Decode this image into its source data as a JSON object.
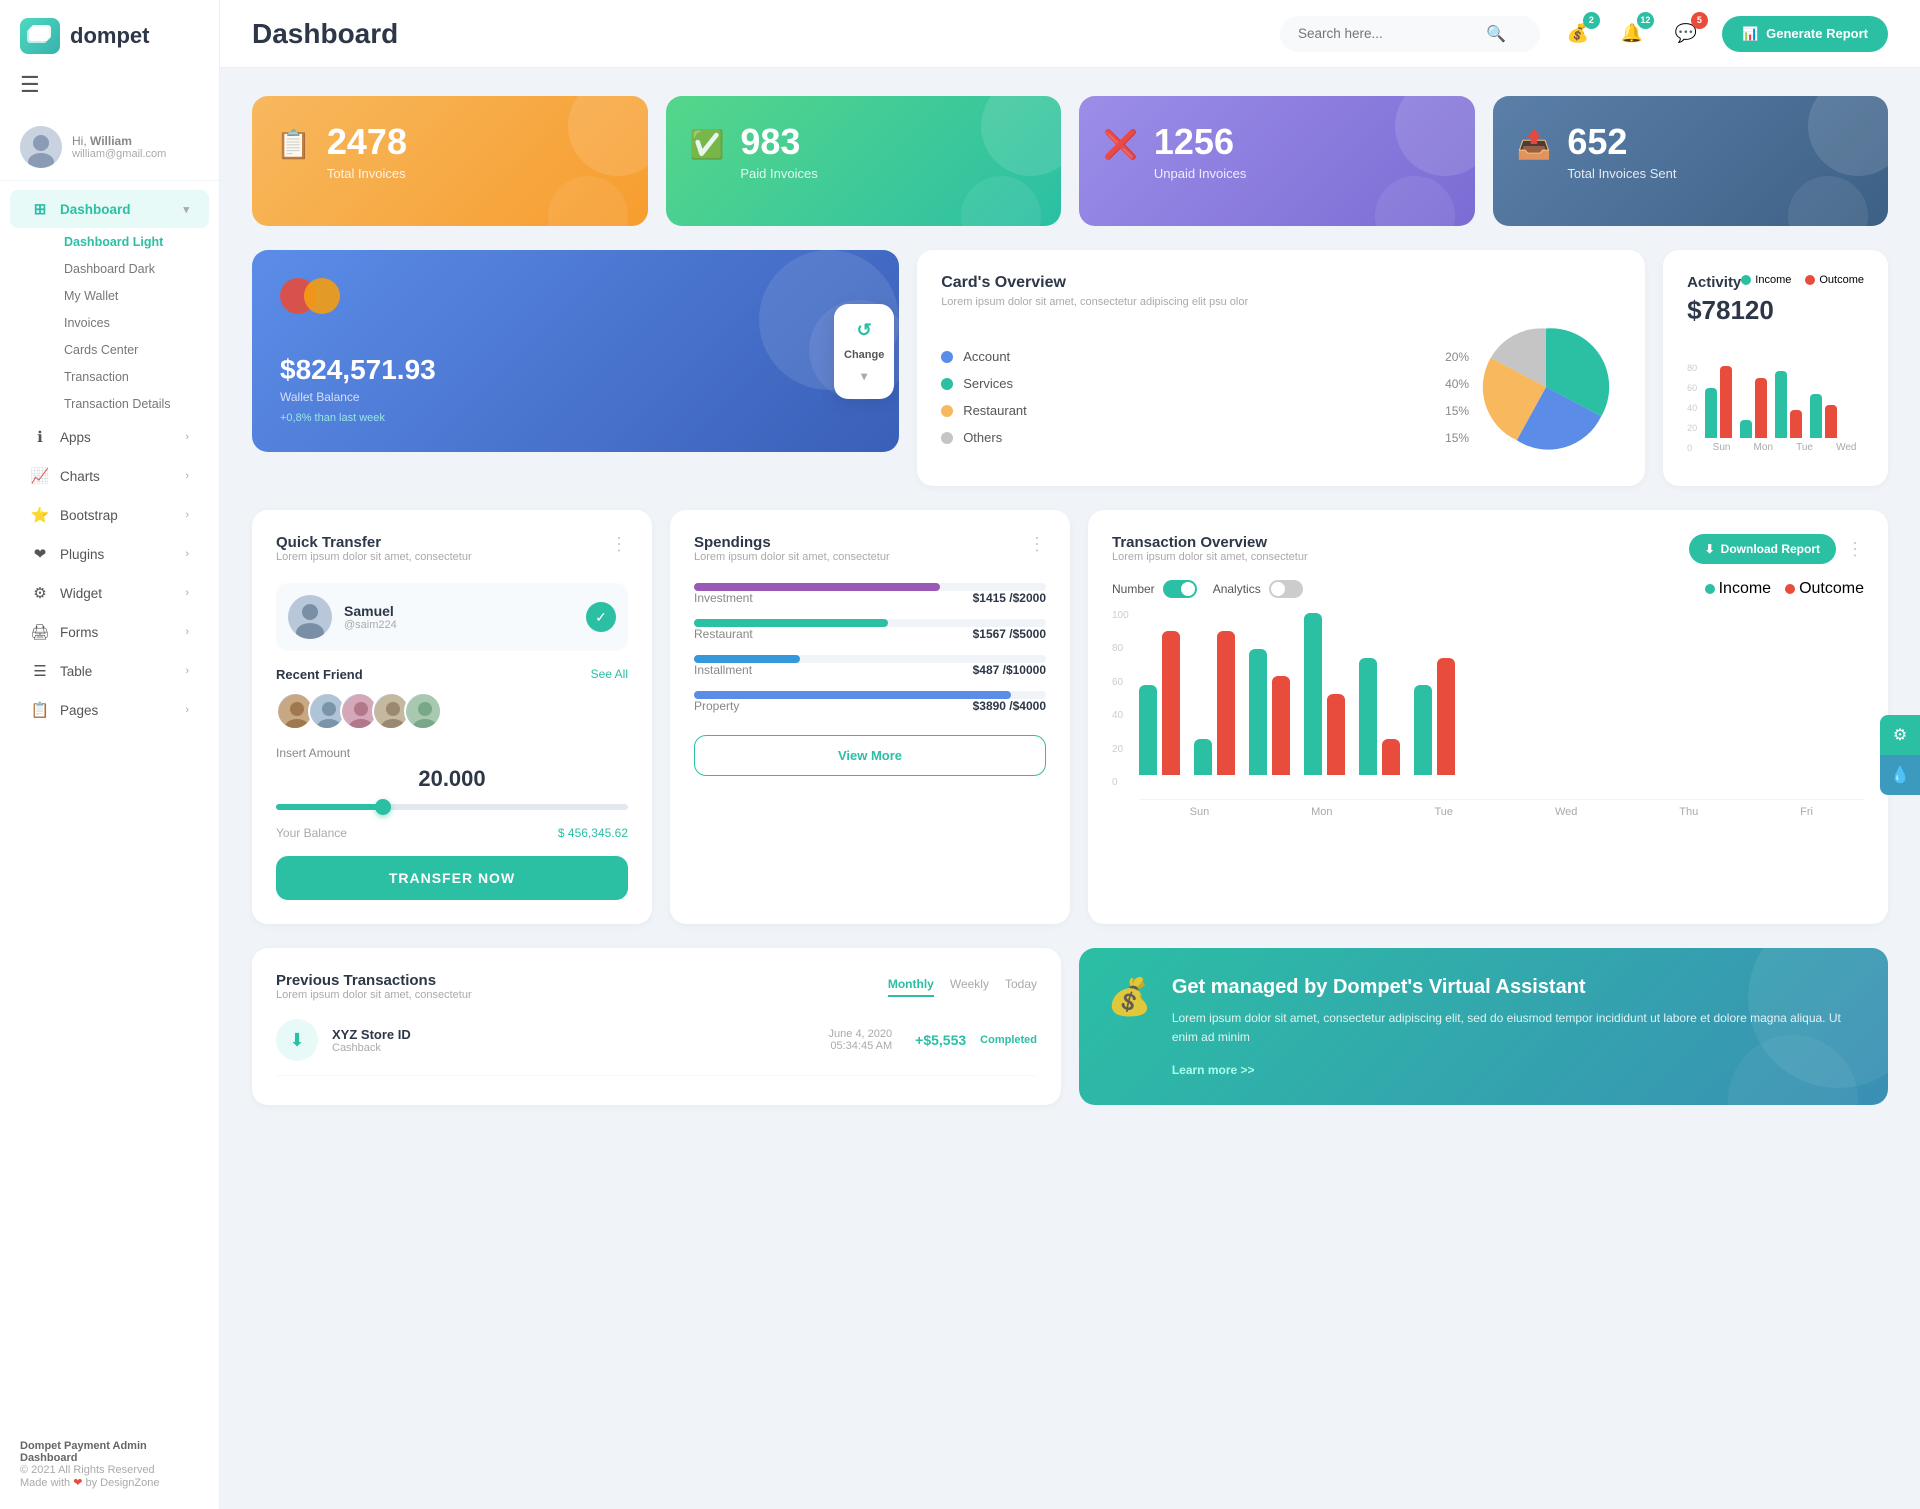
{
  "app": {
    "logo_text": "dompet",
    "logo_icon": "💳"
  },
  "topbar": {
    "page_title": "Dashboard",
    "search_placeholder": "Search here...",
    "notifications": [
      {
        "badge": "2",
        "badge_color": "green"
      },
      {
        "badge": "12",
        "badge_color": "green"
      },
      {
        "badge": "5",
        "badge_color": "red"
      }
    ],
    "generate_btn": "Generate Report"
  },
  "user": {
    "greeting": "Hi,",
    "name": "William",
    "email": "william@gmail.com"
  },
  "sidebar": {
    "dashboard_label": "Dashboard",
    "sub_items": [
      {
        "label": "Dashboard Light",
        "active": true
      },
      {
        "label": "Dashboard Dark"
      },
      {
        "label": "My Wallet"
      },
      {
        "label": "Invoices"
      },
      {
        "label": "Cards Center"
      },
      {
        "label": "Transaction"
      },
      {
        "label": "Transaction Details"
      }
    ],
    "nav_items": [
      {
        "label": "Apps",
        "icon": "ℹ️"
      },
      {
        "label": "Charts",
        "icon": "📈"
      },
      {
        "label": "Bootstrap",
        "icon": "⭐"
      },
      {
        "label": "Plugins",
        "icon": "❤️"
      },
      {
        "label": "Widget",
        "icon": "⚙️"
      },
      {
        "label": "Forms",
        "icon": "🖨️"
      },
      {
        "label": "Table",
        "icon": "☰"
      },
      {
        "label": "Pages",
        "icon": "📋"
      }
    ],
    "footer_brand": "Dompet Payment Admin Dashboard",
    "footer_copy": "© 2021 All Rights Reserved",
    "footer_made": "Made with ❤ by DesignZone"
  },
  "stat_cards": [
    {
      "number": "2478",
      "label": "Total Invoices",
      "color": "orange",
      "icon": "📋"
    },
    {
      "number": "983",
      "label": "Paid Invoices",
      "color": "green",
      "icon": "✅"
    },
    {
      "number": "1256",
      "label": "Unpaid Invoices",
      "color": "purple",
      "icon": "❌"
    },
    {
      "number": "652",
      "label": "Total Invoices Sent",
      "color": "blue-grey",
      "icon": "📤"
    }
  ],
  "wallet_card": {
    "amount": "$824,571.93",
    "label": "Wallet Balance",
    "change": "+0,8% than last week",
    "change_btn": "Change"
  },
  "cards_overview": {
    "title": "Card's Overview",
    "description": "Lorem ipsum dolor sit amet, consectetur adipiscing elit psu olor",
    "legend": [
      {
        "label": "Account",
        "pct": "20%",
        "color": "#5b8de8"
      },
      {
        "label": "Services",
        "pct": "40%",
        "color": "#2bbfa4"
      },
      {
        "label": "Restaurant",
        "pct": "15%",
        "color": "#f7b85e"
      },
      {
        "label": "Others",
        "pct": "15%",
        "color": "#c5c5c5"
      }
    ]
  },
  "activity": {
    "title": "Activity",
    "amount": "$78120",
    "income_label": "Income",
    "outcome_label": "Outcome",
    "income_color": "#2bbfa4",
    "outcome_color": "#e74c3c",
    "bars": [
      {
        "label": "Sun",
        "income": 45,
        "outcome": 65
      },
      {
        "label": "Mon",
        "income": 15,
        "outcome": 55
      },
      {
        "label": "Tue",
        "income": 60,
        "outcome": 25
      },
      {
        "label": "Wed",
        "income": 40,
        "outcome": 30
      }
    ]
  },
  "quick_transfer": {
    "title": "Quick Transfer",
    "description": "Lorem ipsum dolor sit amet, consectetur",
    "user_name": "Samuel",
    "user_handle": "@saim224",
    "recent_title": "Recent Friend",
    "see_all": "See All",
    "amount_label": "Insert Amount",
    "amount_value": "20.000",
    "balance_label": "Your Balance",
    "balance_value": "$ 456,345.62",
    "transfer_btn": "TRANSFER NOW"
  },
  "spendings": {
    "title": "Spendings",
    "description": "Lorem ipsum dolor sit amet, consectetur",
    "items": [
      {
        "label": "Investment",
        "current": 1415,
        "max": 2000,
        "pct": 70,
        "color": "#9b59b6"
      },
      {
        "label": "Restaurant",
        "current": 1567,
        "max": 5000,
        "pct": 55,
        "color": "#2bbfa4"
      },
      {
        "label": "Installment",
        "current": 487,
        "max": 10000,
        "pct": 30,
        "color": "#3498db"
      },
      {
        "label": "Property",
        "current": 3890,
        "max": 4000,
        "pct": 90,
        "color": "#5b8de8"
      }
    ],
    "view_more_btn": "View More"
  },
  "tx_overview": {
    "title": "Transaction Overview",
    "description": "Lorem ipsum dolor sit amet, consectetur",
    "download_btn": "Download Report",
    "toggle_number": "Number",
    "toggle_analytics": "Analytics",
    "income_label": "Income",
    "outcome_label": "Outcome",
    "bars": [
      {
        "label": "Sun",
        "income": 50,
        "outcome": 80
      },
      {
        "label": "Mon",
        "income": 20,
        "outcome": 80
      },
      {
        "label": "Tue",
        "income": 70,
        "outcome": 55
      },
      {
        "label": "Wed",
        "income": 90,
        "outcome": 45
      },
      {
        "label": "Thu",
        "income": 65,
        "outcome": 20
      },
      {
        "label": "Fri",
        "income": 50,
        "outcome": 65
      }
    ],
    "y_labels": [
      "100",
      "80",
      "60",
      "40",
      "20",
      "0"
    ]
  },
  "prev_transactions": {
    "title": "Previous Transactions",
    "description": "Lorem ipsum dolor sit amet, consectetur",
    "tabs": [
      {
        "label": "Monthly",
        "active": true
      },
      {
        "label": "Weekly"
      },
      {
        "label": "Today"
      }
    ],
    "items": [
      {
        "name": "XYZ Store ID",
        "sub": "Cashback",
        "date": "June 4, 2020",
        "time": "05:34:45 AM",
        "amount": "+$5,553",
        "status": "Completed",
        "icon": "⬇"
      }
    ]
  },
  "virtual_assistant": {
    "title": "Get managed by Dompet's Virtual Assistant",
    "description": "Lorem ipsum dolor sit amet, consectetur adipiscing elit, sed do eiusmod tempor incididunt ut labore et dolore magna aliqua. Ut enim ad minim",
    "link": "Learn more >>"
  },
  "colors": {
    "primary": "#2bbfa4",
    "accent": "#3a5fb8",
    "orange": "#f7b85e",
    "purple": "#9b8de8"
  }
}
